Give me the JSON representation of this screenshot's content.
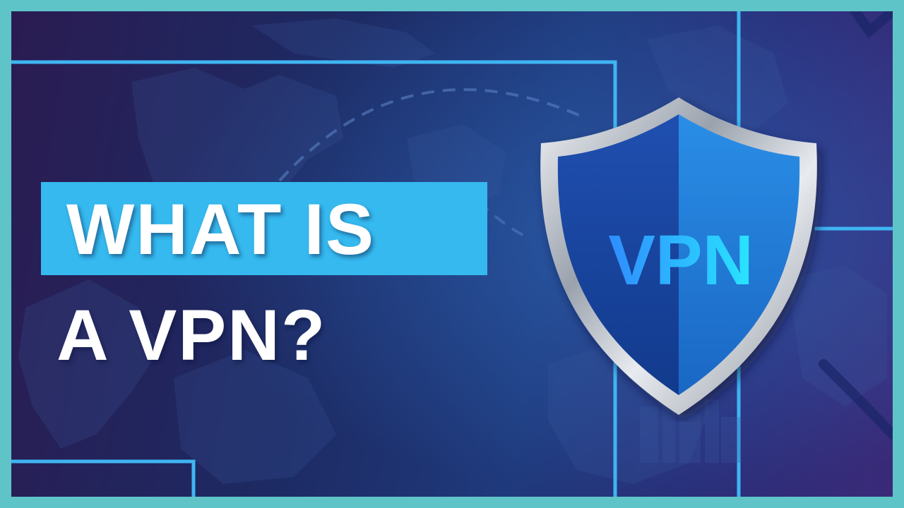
{
  "headline": {
    "line1": "WHAT IS",
    "line2": "A VPN?"
  },
  "shield": {
    "label": "VPN"
  },
  "colors": {
    "frame": "#5fc4c8",
    "highlight_box": "#35b9ef",
    "accent_line": "#3fb5f2",
    "shield_blue": "#1a6fd0",
    "shield_rim": "#c9ced6",
    "label_gradient_start": "#2f8cff",
    "label_gradient_end": "#29e6ff"
  },
  "icons": [
    "vpn-shield-icon",
    "world-map-decoration",
    "circuit-line-decoration"
  ]
}
